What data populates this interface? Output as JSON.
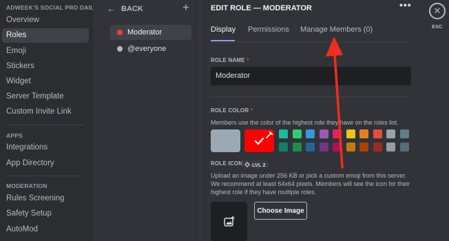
{
  "sidebar": {
    "server_header": "ADWEEK'S SOCIAL PRO DAILY",
    "items": [
      {
        "label": "Overview"
      },
      {
        "label": "Roles"
      },
      {
        "label": "Emoji"
      },
      {
        "label": "Stickers"
      },
      {
        "label": "Widget"
      },
      {
        "label": "Server Template"
      },
      {
        "label": "Custom Invite Link"
      }
    ],
    "apps_header": "APPS",
    "apps_items": [
      {
        "label": "Integrations"
      },
      {
        "label": "App Directory"
      }
    ],
    "moderation_header": "MODERATION",
    "moderation_items": [
      {
        "label": "Rules Screening"
      },
      {
        "label": "Safety Setup"
      },
      {
        "label": "AutoMod"
      }
    ]
  },
  "roles_panel": {
    "back_label": "BACK",
    "back_icon": "arrow-left-icon",
    "add_icon": "plus-icon",
    "roles": [
      {
        "name": "Moderator",
        "color": "#f23f43"
      },
      {
        "name": "@everyone",
        "color": "#b5bac1"
      }
    ]
  },
  "main": {
    "title": "EDIT ROLE — MODERATOR",
    "more_icon": "•••",
    "tabs": [
      {
        "label": "Display"
      },
      {
        "label": "Permissions"
      },
      {
        "label": "Manage Members (0)"
      }
    ],
    "role_name_label": "ROLE NAME",
    "role_name_value": "Moderator",
    "required_mark": "*",
    "role_color_label": "ROLE COLOR",
    "role_color_help": "Members use the color of the highest role they have on the roles list.",
    "default_color": "#99aab5",
    "custom_color": "#ff0000",
    "swatches_top": [
      "#1abc9c",
      "#2ecc71",
      "#3498db",
      "#9b59b6",
      "#e91e63",
      "#f1c40f",
      "#e67e22",
      "#e74c3c",
      "#95a5a6",
      "#607d8b"
    ],
    "swatches_bottom": [
      "#11806a",
      "#1f8b4c",
      "#206694",
      "#71368a",
      "#ad1457",
      "#c27c0e",
      "#a84300",
      "#992d22",
      "#979c9f",
      "#546e7a"
    ],
    "role_icon_label": "ROLE ICON",
    "lvl_badge": "LVL 2",
    "role_icon_help": "Upload an image under 256 KB or pick a custom emoji from this server. We recommend at least 64x64 pixels. Members will see the icon for their highest role if they have multiple roles.",
    "choose_image_label": "Choose Image"
  },
  "close": {
    "icon": "close-icon",
    "esc_label": "ESC"
  },
  "annotation": {
    "arrow_color": "#f02d1e"
  }
}
